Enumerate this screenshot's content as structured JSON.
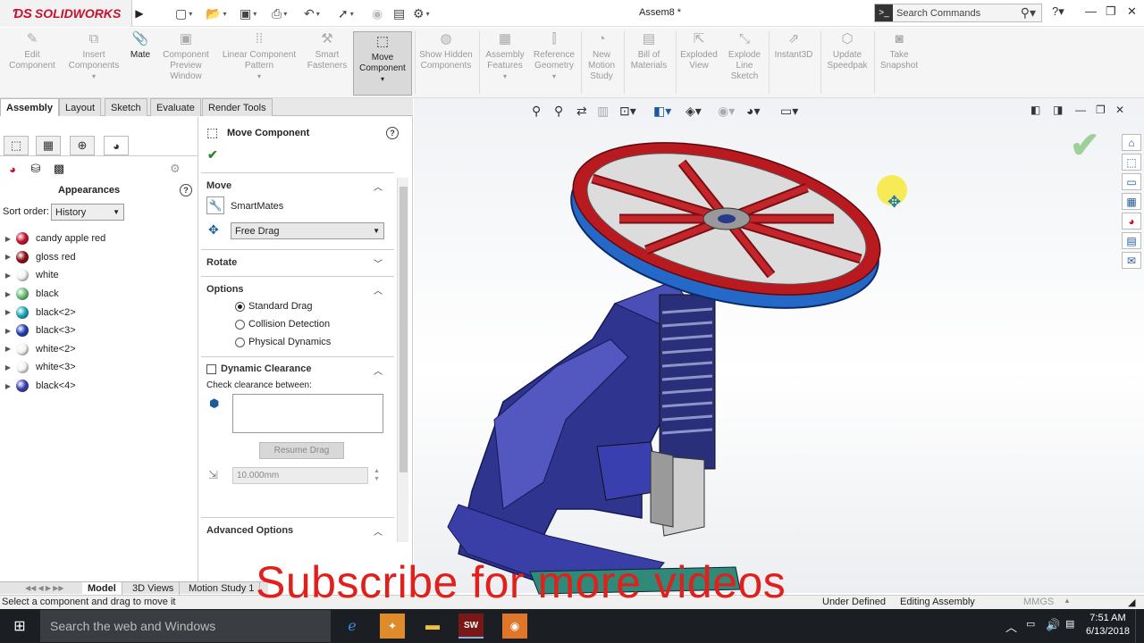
{
  "app": {
    "logo_text": "SOLIDWORKS",
    "doc_title": "Assem8 *",
    "search_placeholder": "Search Commands"
  },
  "ribbon": [
    {
      "label": "Edit Component",
      "state": "disabled"
    },
    {
      "label": "Insert Components",
      "state": "disabled"
    },
    {
      "label": "Mate",
      "state": "enabled"
    },
    {
      "label": "Component Preview Window",
      "state": "disabled"
    },
    {
      "label": "Linear Component Pattern",
      "state": "disabled"
    },
    {
      "label": "Smart Fasteners",
      "state": "disabled"
    },
    {
      "label": "Move Component",
      "state": "active"
    },
    {
      "label": "Show Hidden Components",
      "state": "disabled"
    },
    {
      "label": "Assembly Features",
      "state": "disabled"
    },
    {
      "label": "Reference Geometry",
      "state": "disabled"
    },
    {
      "label": "New Motion Study",
      "state": "disabled"
    },
    {
      "label": "Bill of Materials",
      "state": "disabled"
    },
    {
      "label": "Exploded View",
      "state": "disabled"
    },
    {
      "label": "Explode Line Sketch",
      "state": "disabled"
    },
    {
      "label": "Instant3D",
      "state": "disabled"
    },
    {
      "label": "Update Speedpak",
      "state": "disabled"
    },
    {
      "label": "Take Snapshot",
      "state": "disabled"
    }
  ],
  "tabs": [
    "Assembly",
    "Layout",
    "Sketch",
    "Evaluate",
    "Render Tools"
  ],
  "active_tab": "Assembly",
  "left_panel": {
    "title": "Appearances",
    "sort_label": "Sort order:",
    "sort_value": "History",
    "items": [
      {
        "label": "candy apple red",
        "color": "#c8102e"
      },
      {
        "label": "gloss red",
        "color": "#8b0a14"
      },
      {
        "label": "white",
        "color": "#f2f2f2"
      },
      {
        "label": "black",
        "color": "#6cbf7a"
      },
      {
        "label": "black<2>",
        "color": "#1aa6b7"
      },
      {
        "label": "black<3>",
        "color": "#1f3fae"
      },
      {
        "label": "white<2>",
        "color": "#f2f2f2"
      },
      {
        "label": "white<3>",
        "color": "#f2f2f2"
      },
      {
        "label": "black<4>",
        "color": "#3a3fb2"
      }
    ]
  },
  "property_manager": {
    "title": "Move Component",
    "move": {
      "header": "Move",
      "smartmates": "SmartMates",
      "drag_mode": "Free Drag"
    },
    "rotate": {
      "header": "Rotate"
    },
    "options": {
      "header": "Options",
      "choices": [
        "Standard Drag",
        "Collision Detection",
        "Physical Dynamics"
      ],
      "selected": "Standard Drag"
    },
    "clearance": {
      "header": "Dynamic Clearance",
      "check_label": "Check clearance between:",
      "resume": "Resume Drag",
      "distance": "10.000mm"
    },
    "advanced": {
      "header": "Advanced Options"
    }
  },
  "bottom_tabs": [
    "Model",
    "3D Views",
    "Motion Study 1"
  ],
  "status": {
    "message": "Select a component and drag to move it",
    "state": "Under Defined",
    "mode": "Editing Assembly",
    "units": "MMGS"
  },
  "overlay_text": "Subscribe for more videos",
  "taskbar": {
    "search": "Search the web and Windows",
    "time": "7:51 AM",
    "date": "6/13/2018"
  }
}
